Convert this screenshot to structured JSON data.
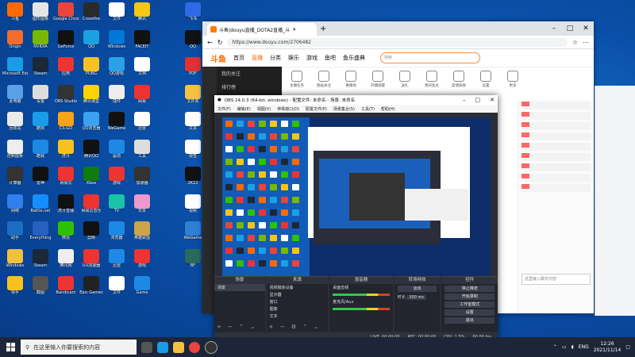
{
  "desktop_icons": [
    {
      "label": "斗鱼",
      "color": "#ff6a00"
    },
    {
      "label": "图形图像",
      "color": "#e5e5e5"
    },
    {
      "label": "Google Chrome",
      "color": "#e8453c"
    },
    {
      "label": "Crossfire",
      "color": "#2a2a2a"
    },
    {
      "label": "文件",
      "color": "#ffffff"
    },
    {
      "label": "腾讯",
      "color": "#f5c518"
    },
    {
      "label": "飞书",
      "color": "#2f6ae6"
    },
    {
      "label": "Origin",
      "color": "#f56c2d"
    },
    {
      "label": "NVIDIA",
      "color": "#76b900"
    },
    {
      "label": "GeForce",
      "color": "#111"
    },
    {
      "label": "QQ",
      "color": "#1ba1e2"
    },
    {
      "label": "Windows",
      "color": "#0078d7"
    },
    {
      "label": "FACEIT",
      "color": "#111"
    },
    {
      "label": "QQ",
      "color": "#111"
    },
    {
      "label": "Microsoft Edge",
      "color": "#1a9be6"
    },
    {
      "label": "Steam",
      "color": "#1b2838"
    },
    {
      "label": "应用",
      "color": "#e33"
    },
    {
      "label": "PUBG",
      "color": "#f7c21f"
    },
    {
      "label": "QQ游戏",
      "color": "#29a3e5"
    },
    {
      "label": "文档",
      "color": "#fff"
    },
    {
      "label": "PDF",
      "color": "#d33"
    },
    {
      "label": "此电脑",
      "color": "#5aa0e8"
    },
    {
      "label": "设置",
      "color": "#ddd"
    },
    {
      "label": "OBS Studio",
      "color": "#333"
    },
    {
      "label": "腾讯课堂",
      "color": "#ffd200"
    },
    {
      "label": "插件",
      "color": "#eee"
    },
    {
      "label": "网易",
      "color": "#e33"
    },
    {
      "label": "文件夹",
      "color": "#f4c242"
    },
    {
      "label": "回收站",
      "color": "#eaeaea"
    },
    {
      "label": "酷狗",
      "color": "#1b9cea"
    },
    {
      "label": "CS:GO",
      "color": "#f7a31b"
    },
    {
      "label": "QQ浏览器",
      "color": "#3aa2f0"
    },
    {
      "label": "WeGame",
      "color": "#111"
    },
    {
      "label": "迅雷",
      "color": "#fff"
    },
    {
      "label": "文本",
      "color": "#fff"
    },
    {
      "label": "控制面板",
      "color": "#eee"
    },
    {
      "label": "酷我",
      "color": "#1e88e5"
    },
    {
      "label": "虎牙",
      "color": "#f7c21f"
    },
    {
      "label": "腾讯QQ",
      "color": "#111"
    },
    {
      "label": "驱动",
      "color": "#1e88e5"
    },
    {
      "label": "工具",
      "color": "#ddd"
    },
    {
      "label": "便签",
      "color": "#fff"
    },
    {
      "label": "计算器",
      "color": "#333"
    },
    {
      "label": "雷神",
      "color": "#111"
    },
    {
      "label": "网易云",
      "color": "#e33"
    },
    {
      "label": "Xbox",
      "color": "#107c10"
    },
    {
      "label": "游戏",
      "color": "#e33"
    },
    {
      "label": "加速器",
      "color": "#333"
    },
    {
      "label": "2K22",
      "color": "#111"
    },
    {
      "label": "网络",
      "color": "#2f80ed"
    },
    {
      "label": "Battle.net",
      "color": "#148eff"
    },
    {
      "label": "虎牙直播",
      "color": "#111"
    },
    {
      "label": "网易云音乐",
      "color": "#e33"
    },
    {
      "label": "TV",
      "color": "#19c3a8"
    },
    {
      "label": "日本",
      "color": "#e9c"
    },
    {
      "label": "视频",
      "color": "#fff"
    },
    {
      "label": "助手",
      "color": "#1b6ec2"
    },
    {
      "label": "Everything",
      "color": "#2860c1"
    },
    {
      "label": "微信",
      "color": "#2dc100"
    },
    {
      "label": "剪映",
      "color": "#111"
    },
    {
      "label": "浏览器",
      "color": "#1e88e5"
    },
    {
      "label": "英雄联盟",
      "color": "#c9a44b"
    },
    {
      "label": "WeGame",
      "color": "#2e7fd6"
    },
    {
      "label": "Windows",
      "color": "#f0c040"
    },
    {
      "label": "Steam",
      "color": "#1b2838"
    },
    {
      "label": "腾讯网",
      "color": "#eee"
    },
    {
      "label": "UU加速器",
      "color": "#e33"
    },
    {
      "label": "迅雷",
      "color": "#1e88e5"
    },
    {
      "label": "游戏",
      "color": "#e33"
    },
    {
      "label": "BF",
      "color": "#2a6a5a"
    },
    {
      "label": "快手",
      "color": "#f7c21f"
    },
    {
      "label": "截图",
      "color": "#555"
    },
    {
      "label": "Bandicam",
      "color": "#e33"
    },
    {
      "label": "Epic Games",
      "color": "#222"
    },
    {
      "label": "文件",
      "color": "#fff"
    },
    {
      "label": "Game",
      "color": "#1e88e5"
    }
  ],
  "browser": {
    "tab_title": "斗鱼|douyu直播_DOTA2直播_斗",
    "url": "https://www.douyu.com/2706482",
    "nav": [
      "首页",
      "直播",
      "分类",
      "娱乐",
      "游戏",
      "鱼吧",
      "鱼乐盛典"
    ],
    "search_placeholder": "搜索",
    "categories": [
      "主播任务",
      "图画关注",
      "重播地",
      "开播提醒",
      "送礼",
      "我的鱼丸",
      "友情链接",
      "设置",
      "更多"
    ],
    "sidebar": [
      "我的关注",
      "排行榜",
      "分类",
      "娱乐"
    ],
    "chat_input": "这里输入聊天内容"
  },
  "obs": {
    "title": "OBS 24.0.3 (64-bit, windows) - 配置文件: 未命名 - 场景: 未命名",
    "menu": [
      "文件(F)",
      "编辑(E)",
      "视图(V)",
      "停靠窗口(D)",
      "配置文件(P)",
      "场景集合(S)",
      "工具(T)",
      "帮助(H)"
    ],
    "docks": {
      "scenes": "场景",
      "scene_item": "场景",
      "sources": "来源",
      "source_items": [
        "视频捕获设备",
        "显示器",
        "窗口",
        "图像",
        "文本"
      ],
      "mixer": "混音器",
      "mixer_items": [
        "桌面音频",
        "麦克风/Aux"
      ],
      "transitions": "转场特效",
      "transition_value": "淡出",
      "duration_label": "时长",
      "duration_value": "300 ms",
      "controls": "控件",
      "control_buttons": [
        "停止推流",
        "开始录制",
        "工作室模式",
        "设置",
        "退出"
      ]
    },
    "status": [
      "LIVE: 00:00:00",
      "REC: 00:00:00",
      "CPU: 1.5%",
      "60.00 fps"
    ]
  },
  "taskbar": {
    "search_placeholder": "在这里输入你要搜索的内容",
    "lang": "ENG",
    "time": "12:26",
    "date": "2021/11/14"
  }
}
